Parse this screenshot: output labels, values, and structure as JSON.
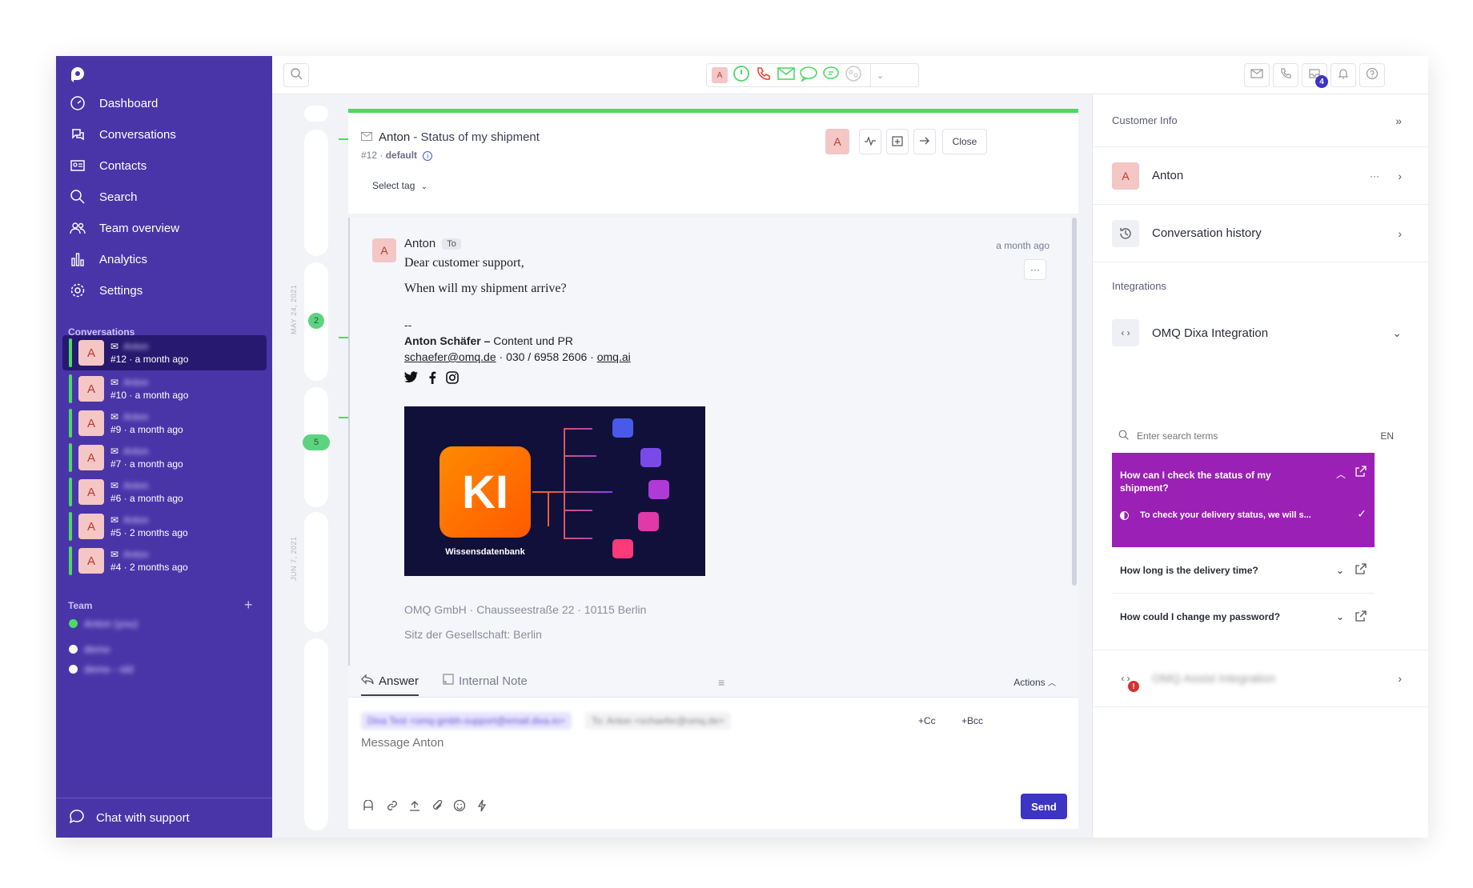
{
  "colors": {
    "sidebar": "#4a35a8",
    "sidebar_active": "#271970",
    "accent_green": "#4cd964",
    "send": "#3d34c4",
    "faq_active": "#9b20b5",
    "avatar_bg": "#f4c6c6"
  },
  "sidebar": {
    "nav": [
      {
        "label": "Dashboard",
        "icon": "dashboard-icon"
      },
      {
        "label": "Conversations",
        "icon": "conversations-icon"
      },
      {
        "label": "Contacts",
        "icon": "contacts-icon"
      },
      {
        "label": "Search",
        "icon": "search-icon"
      },
      {
        "label": "Team overview",
        "icon": "team-icon"
      },
      {
        "label": "Analytics",
        "icon": "analytics-icon"
      },
      {
        "label": "Settings",
        "icon": "settings-icon"
      }
    ],
    "conversations_heading": "Conversations",
    "conversations": [
      {
        "avatar": "A",
        "name": "Anton",
        "sub": "#12 · a month ago"
      },
      {
        "avatar": "A",
        "name": "Anton",
        "sub": "#10 · a month ago"
      },
      {
        "avatar": "A",
        "name": "Anton",
        "sub": "#9 · a month ago"
      },
      {
        "avatar": "A",
        "name": "Anton",
        "sub": "#7 · a month ago"
      },
      {
        "avatar": "A",
        "name": "Anton",
        "sub": "#6 · a month ago"
      },
      {
        "avatar": "A",
        "name": "Anton",
        "sub": "#5 · 2 months ago"
      },
      {
        "avatar": "A",
        "name": "Anton",
        "sub": "#4 · 2 months ago"
      }
    ],
    "team_heading": "Team",
    "team_add": "+",
    "team": [
      {
        "name": "Anton (you)"
      },
      {
        "name": "demo"
      },
      {
        "name": "demo - old"
      }
    ],
    "chat_support": "Chat with support"
  },
  "topbar": {
    "avatar": "A",
    "notification_count": "4"
  },
  "timeline": {
    "counts": [
      "2",
      "5"
    ],
    "dates": [
      "MAY 24, 2021",
      "JUN 7, 2021"
    ]
  },
  "conversation": {
    "contact": "Anton",
    "subject": " - Status of my shipment",
    "id": "#12 · ",
    "inbox": "default",
    "select_tag": "Select tag",
    "avatar": "A",
    "close_label": "Close"
  },
  "message": {
    "from": "Anton",
    "to_label": "To",
    "time": "a month ago",
    "more": "···",
    "greeting": "Dear customer support,",
    "body": "When will my shipment arrive?",
    "sig_sep": "--",
    "sig_name": "Anton Schäfer",
    "sig_dash": " – ",
    "sig_role": "Content und PR",
    "sig_email": "schaefer@omq.de",
    "sig_phone": "030 / 6958 2606",
    "sig_web": "omq.ai",
    "promo_ki": "KI",
    "promo_label": "Wissensdatenbank",
    "footer_address": "OMQ GmbH · Chausseestraße 22 · 10115 Berlin",
    "footer_seat": "Sitz der Gesellschaft: Berlin"
  },
  "compose": {
    "tab_answer": "Answer",
    "tab_note": "Internal Note",
    "actions": "Actions",
    "from_address": "Dixa Test <omq-gmbh-support@email.dixa.io>",
    "to_address": "To: Anton <schaefer@omq.de>",
    "cc": "+Cc",
    "bcc": "+Bcc",
    "placeholder": "Message Anton",
    "send": "Send"
  },
  "right_panel": {
    "customer_info": "Customer Info",
    "customer_name": "Anton",
    "customer_avatar": "A",
    "history": "Conversation history",
    "integrations": "Integrations",
    "omq_integration": "OMQ Dixa Integration",
    "search_placeholder": "Enter search terms",
    "lang": "EN",
    "faq_active_q": "How can I check the status of my shipment?",
    "faq_active_a": "To check your delivery status, we will s...",
    "faq": [
      {
        "q": "How long is the delivery time?"
      },
      {
        "q": "How could I change my password?"
      }
    ],
    "assist_integration": "OMQ Assist Integration"
  }
}
